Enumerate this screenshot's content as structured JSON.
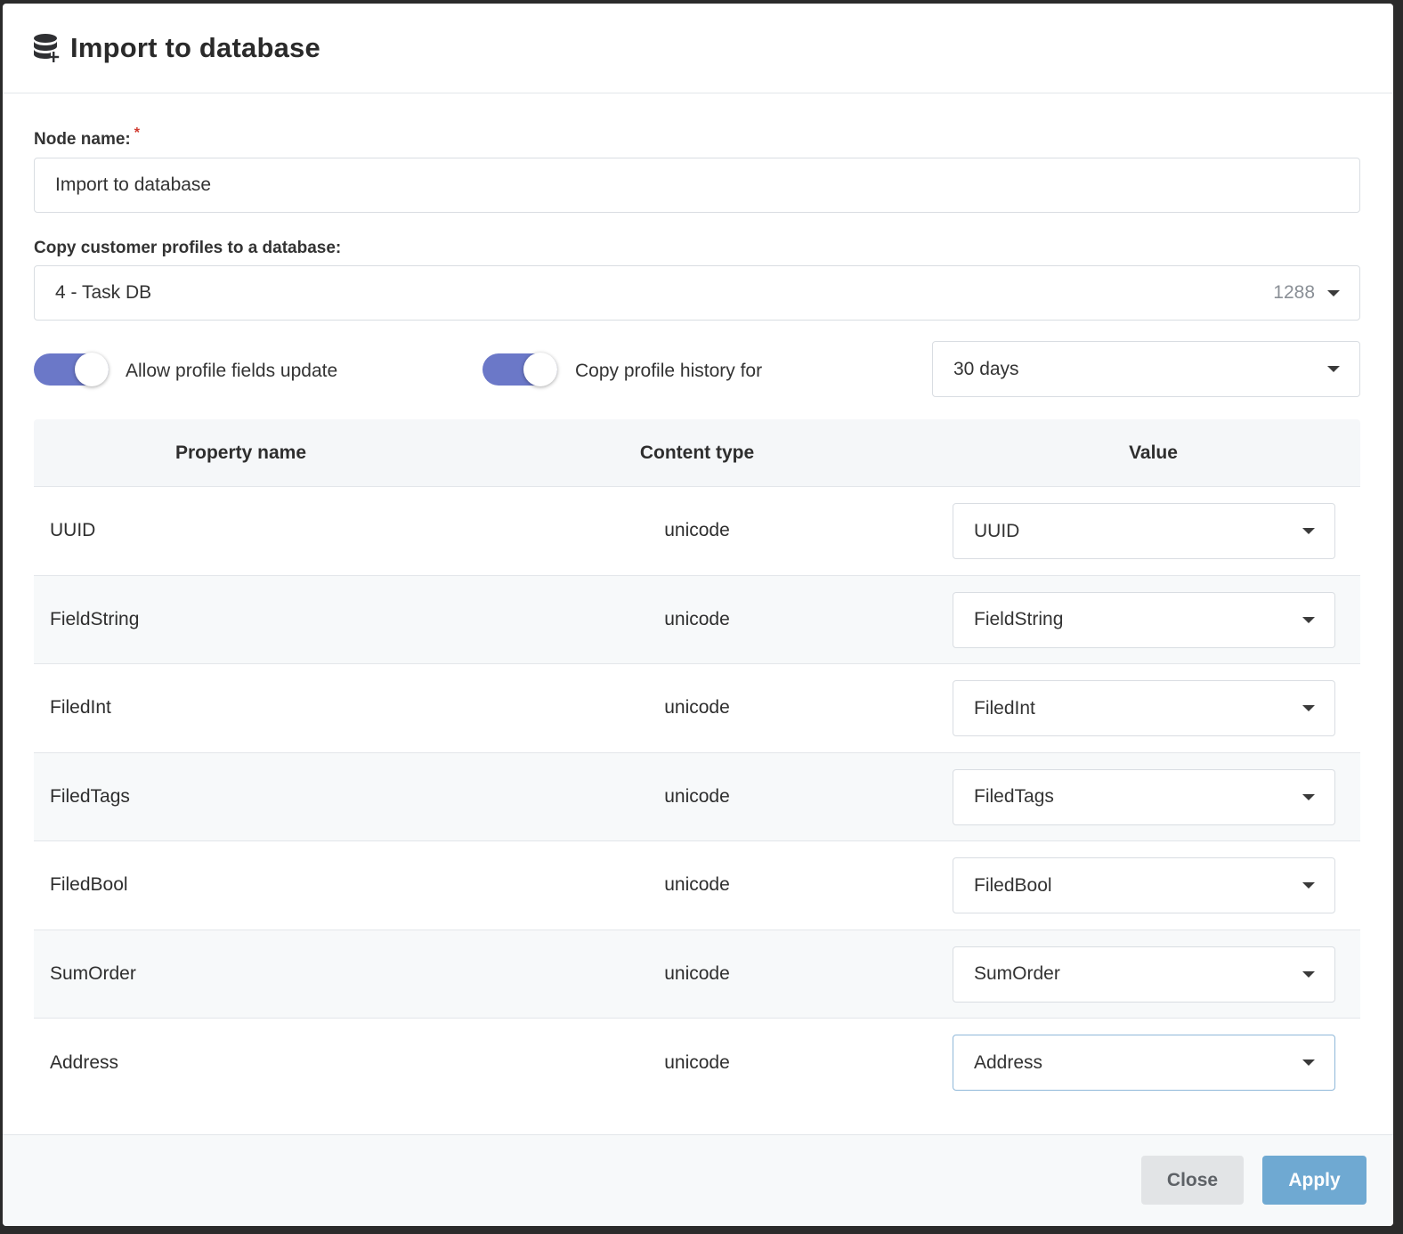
{
  "dialog": {
    "title": "Import to database",
    "icon": "database-add-icon"
  },
  "node_name": {
    "label": "Node name:",
    "required_mark": "*",
    "value": "Import to database"
  },
  "database": {
    "label": "Copy customer profiles to a database:",
    "selected": "4 - Task DB",
    "count": "1288"
  },
  "options": {
    "allow_update": {
      "label": "Allow profile fields update",
      "enabled": true
    },
    "copy_history": {
      "label": "Copy profile history for",
      "enabled": true
    },
    "history_period": "30 days"
  },
  "table": {
    "headers": [
      "Property name",
      "Content type",
      "Value"
    ],
    "rows": [
      {
        "name": "UUID",
        "type": "unicode",
        "value": "UUID"
      },
      {
        "name": "FieldString",
        "type": "unicode",
        "value": "FieldString"
      },
      {
        "name": "FiledInt",
        "type": "unicode",
        "value": "FiledInt"
      },
      {
        "name": "FiledTags",
        "type": "unicode",
        "value": "FiledTags"
      },
      {
        "name": "FiledBool",
        "type": "unicode",
        "value": "FiledBool"
      },
      {
        "name": "SumOrder",
        "type": "unicode",
        "value": "SumOrder"
      },
      {
        "name": "Address",
        "type": "unicode",
        "value": "Address"
      }
    ]
  },
  "footer": {
    "close_label": "Close",
    "apply_label": "Apply"
  },
  "colors": {
    "toggle_on": "#6b78c8",
    "apply_button": "#6fa9d2",
    "close_button": "#e2e4e6"
  }
}
